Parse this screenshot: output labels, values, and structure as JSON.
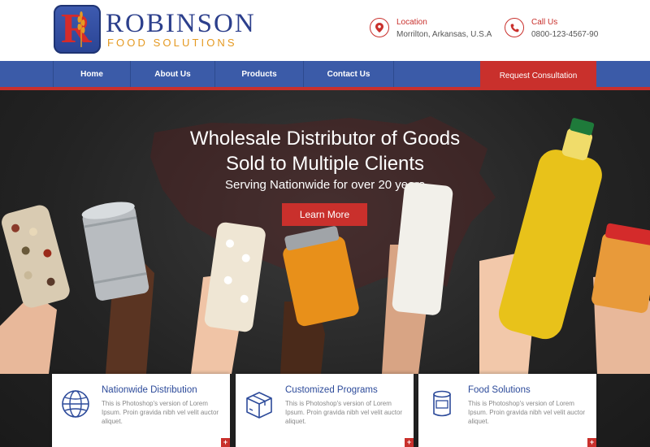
{
  "brand": {
    "name": "ROBINSON",
    "tagline": "FOOD SOLUTIONS",
    "badge_letter": "R"
  },
  "contact": {
    "location": {
      "title": "Location",
      "text": "Morrilton, Arkansas, U.S.A",
      "icon": "map-pin-icon"
    },
    "call": {
      "title": "Call Us",
      "text": "0800-123-4567-90",
      "icon": "phone-icon"
    }
  },
  "nav": {
    "items": [
      {
        "label": "Home"
      },
      {
        "label": "About Us"
      },
      {
        "label": "Products"
      },
      {
        "label": "Contact Us"
      }
    ],
    "cta": "Request Consultation"
  },
  "hero": {
    "title_line1": "Wholesale Distributor of Goods",
    "title_line2": "Sold to Multiple Clients",
    "subtitle": "Serving Nationwide for over 20 years",
    "button": "Learn More"
  },
  "cards": [
    {
      "title": "Nationwide Distribution",
      "text": "This is Photoshop's version  of Lorem Ipsum. Proin gravida nibh vel velit auctor aliquet.",
      "icon": "globe-icon"
    },
    {
      "title": "Customized Programs",
      "text": "This is Photoshop's version  of Lorem Ipsum. Proin gravida nibh vel velit auctor aliquet.",
      "icon": "box-icon"
    },
    {
      "title": "Food Solutions",
      "text": "This is Photoshop's version  of Lorem Ipsum. Proin gravida nibh vel velit auctor aliquet.",
      "icon": "can-icon"
    }
  ],
  "colors": {
    "primary_blue": "#3b5ba8",
    "accent_red": "#c9302c",
    "brand_orange": "#e59a22",
    "hero_dark": "#232323"
  }
}
